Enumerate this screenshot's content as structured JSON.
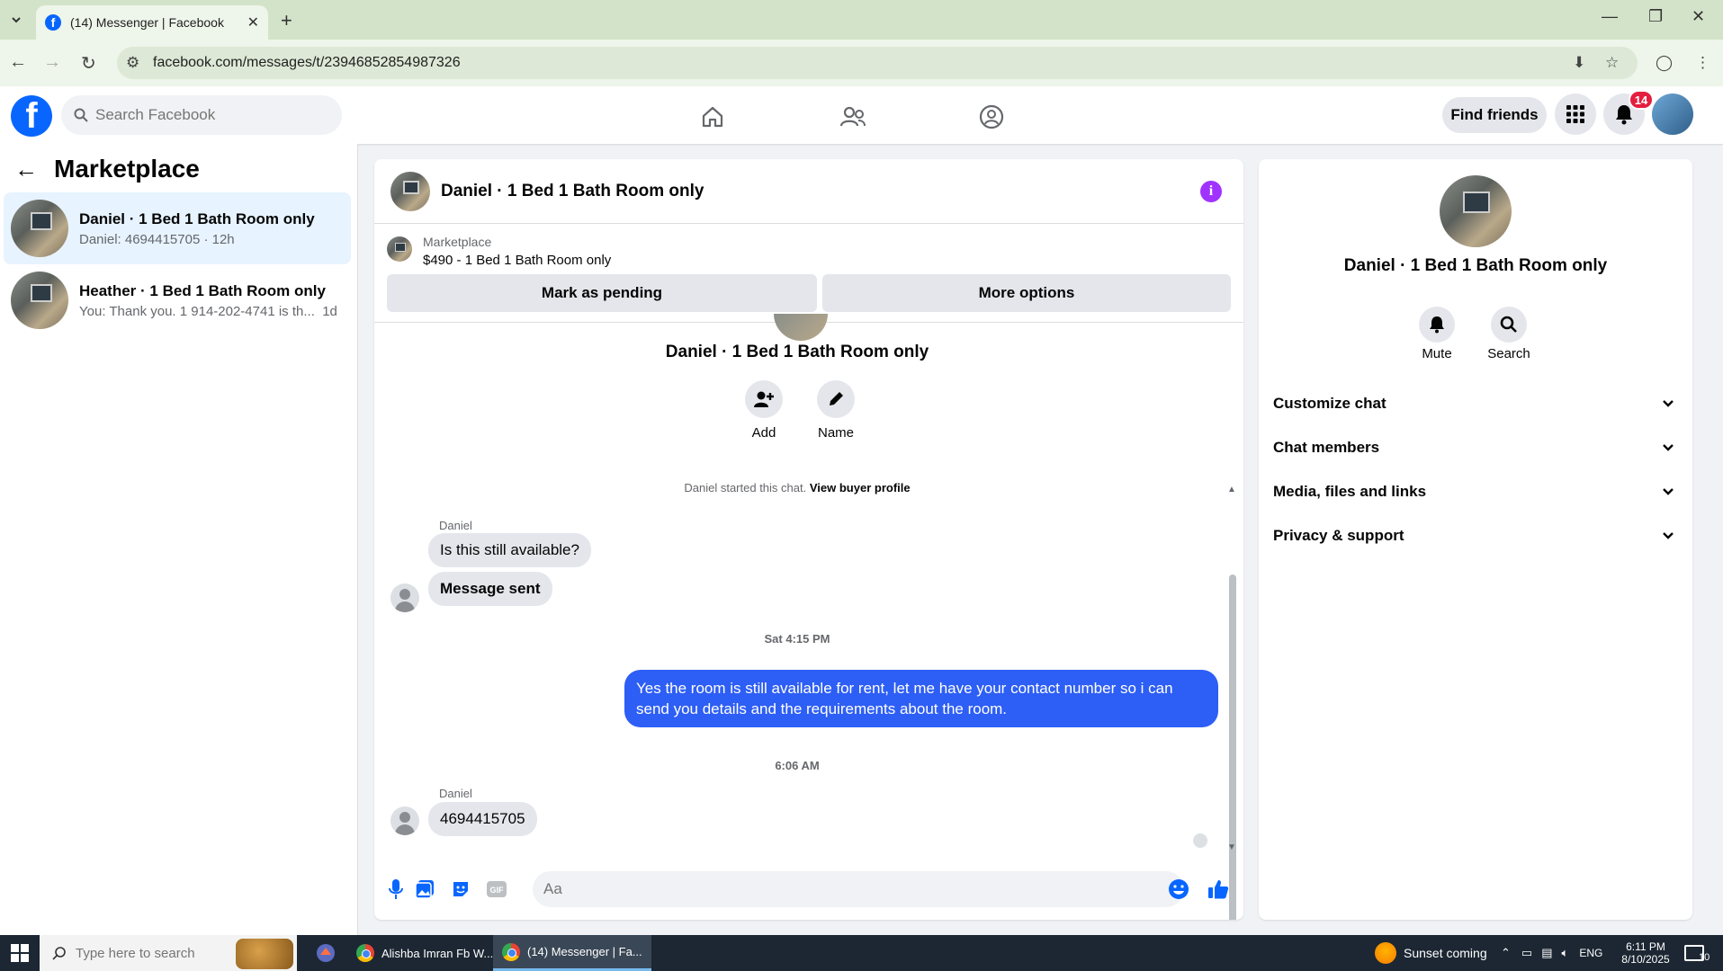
{
  "browser": {
    "tab_title": "(14) Messenger | Facebook",
    "url": "facebook.com/messages/t/23946852854987326"
  },
  "fb_header": {
    "search_placeholder": "Search Facebook",
    "find_friends_label": "Find friends",
    "notification_count": "14"
  },
  "left_panel": {
    "title": "Marketplace",
    "conversations": [
      {
        "title": "Daniel · 1 Bed 1 Bath Room only",
        "preview": "Daniel: 4694415705 · 12h"
      },
      {
        "title": "Heather · 1 Bed 1 Bath Room only",
        "preview": "You: Thank you. 1 914-202-4741 is th...",
        "time": "1d"
      }
    ]
  },
  "chat": {
    "title": "Daniel · 1 Bed 1 Bath Room only",
    "marketplace_label": "Marketplace",
    "listing": "$490 - 1 Bed 1 Bath Room only",
    "mark_pending_label": "Mark as pending",
    "more_options_label": "More options",
    "center_name": "Daniel · 1 Bed 1 Bath Room only",
    "add_label": "Add",
    "name_label": "Name",
    "started_text": "Daniel started this chat.",
    "view_buyer_label": "View buyer profile",
    "sender_name": "Daniel",
    "msg_1": "Is this still available?",
    "msg_2": "Message sent",
    "time_1": "Sat 4:15 PM",
    "msg_out": "Yes the room is still available for rent, let me have your contact number so i can send you details and the requirements about the room.",
    "time_2": "6:06 AM",
    "msg_3": "4694415705",
    "composer_placeholder": "Aa"
  },
  "right_panel": {
    "name": "Daniel · 1 Bed 1 Bath Room only",
    "mute_label": "Mute",
    "search_label": "Search",
    "sections": [
      "Customize chat",
      "Chat members",
      "Media, files and links",
      "Privacy & support"
    ]
  },
  "taskbar": {
    "search_placeholder": "Type here to search",
    "app_1": "Alishba Imran Fb W...",
    "app_2": "(14) Messenger | Fa...",
    "weather": "Sunset coming",
    "lang": "ENG",
    "time": "6:11 PM",
    "date": "8/10/2025",
    "notif_count": "10"
  },
  "colors": {
    "accent_blue": "#0866ff",
    "outgoing_bubble": "#2d5ef5",
    "info_purple": "#a033ff",
    "badge_red": "#e41e3f"
  }
}
